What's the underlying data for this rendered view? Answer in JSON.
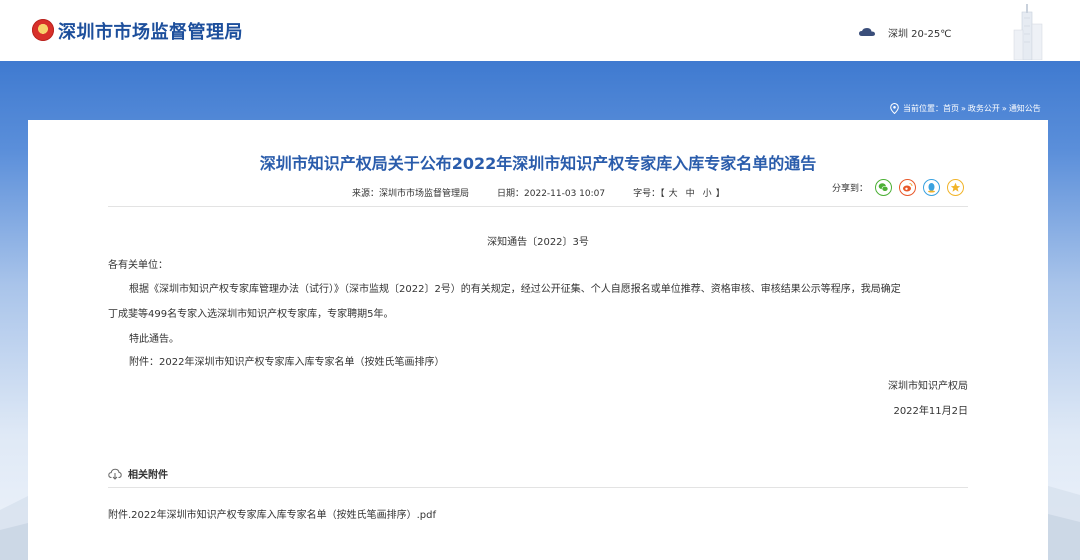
{
  "header": {
    "site_title": "深圳市市场监督管理局",
    "weather": "深圳 20-25℃"
  },
  "breadcrumb": {
    "prefix": "当前位置：",
    "items": [
      "首页",
      "政务公开",
      "通知公告"
    ],
    "separator": "»"
  },
  "article": {
    "title": "深圳市知识产权局关于公布2022年深圳市知识产权专家库入库专家名单的通告",
    "meta": {
      "source": "来源：深圳市市场监督管理局",
      "date": "日期：2022-11-03 10:07",
      "font_size_label": "字号：【",
      "font_size_large": "大",
      "font_size_medium": "中",
      "font_size_small": "小",
      "font_size_end": "】"
    },
    "share_label": "分享到：",
    "doc_number": "深知通告〔2022〕3号",
    "salutation": "各有关单位：",
    "para1_line1": "根据《深圳市知识产权专家库管理办法（试行）》（深市监规〔2022〕2号）的有关规定，经过公开征集、个人自愿报名或单位推荐、资格审核、审核结果公示等程序，我局确定",
    "para1_line2": "丁成斐等499名专家入选深圳市知识产权专家库，专家聘期5年。",
    "notice": "特此通告。",
    "attachment_line": "附件：2022年深圳市知识产权专家库入库专家名单（按姓氏笔画排序）",
    "signer": "深圳市知识产权局",
    "sign_date": "2022年11月2日"
  },
  "attachments": {
    "heading": "相关附件",
    "files": [
      "附件.2022年深圳市知识产权专家库入库专家名单（按姓氏笔画排序）.pdf"
    ]
  },
  "colors": {
    "title_blue": "#2a5cab",
    "logo_blue": "#1d4f9c",
    "band_blue": "#3f7ad0",
    "wechat": "#4cb035",
    "weibo": "#e8582a",
    "qq": "#3aa2e0",
    "qzone": "#f1b42a"
  },
  "icons": [
    "emblem-icon",
    "cloud-icon",
    "location-pin-icon",
    "wechat-icon",
    "weibo-icon",
    "qq-icon",
    "qzone-icon",
    "download-icon"
  ]
}
